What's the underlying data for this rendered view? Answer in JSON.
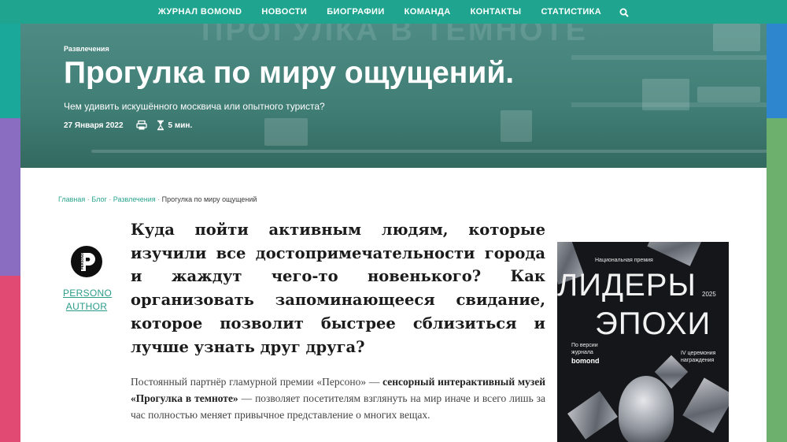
{
  "nav": {
    "items": [
      "ЖУРНАЛ BOMOND",
      "НОВОСТИ",
      "БИОГРАФИИ",
      "КОМАНДА",
      "КОНТАКТЫ",
      "СТАТИСТИКА"
    ],
    "search_icon": "search-icon"
  },
  "hero": {
    "category": "Развлечения",
    "title": "Прогулка по миру ощущений.",
    "subtitle": "Чем удивить искушённого москвича или опытного туриста?",
    "date": "27 Января 2022",
    "print_icon": "print-icon",
    "read_icon": "hourglass-icon",
    "read_time": "5 мин."
  },
  "breadcrumbs": {
    "home": "Главная",
    "blog": "Блог",
    "category": "Развлечения",
    "current": "Прогулка по миру ощущений",
    "separator": "·"
  },
  "author": {
    "logo_text": "PERSONO",
    "name_line1": "PERSONO",
    "name_line2": "AUTHOR"
  },
  "article": {
    "lead": "Куда пойти активным людям, которые изучили все достопримечательности города и жаждут чего-то новенького? Как организовать запоминающееся свидание, которое позволит быстрее сблизиться и лучше узнать друг друга?",
    "body_part1": "Постоянный партнёр гламурной премии «Персоно» — ",
    "body_bold": "сенсорный интерактивный музей «Прогулка в темноте»",
    "body_part2": " — позволяет посетителям взглянуть на мир иначе и всего лишь за час полностью меняет привычное представление о многих вещах."
  },
  "ad": {
    "award": "Национальная премия",
    "line1": "ЛИДЕРЫ",
    "line2": "ЭПОХИ",
    "year": "2025",
    "version": "По версии журнала",
    "brand": "bomond",
    "ceremony": "IV церемония награждения"
  },
  "colors": {
    "nav": "#1fa58f",
    "link": "#2ba58f",
    "hero_overlay": "#4e8b84"
  }
}
